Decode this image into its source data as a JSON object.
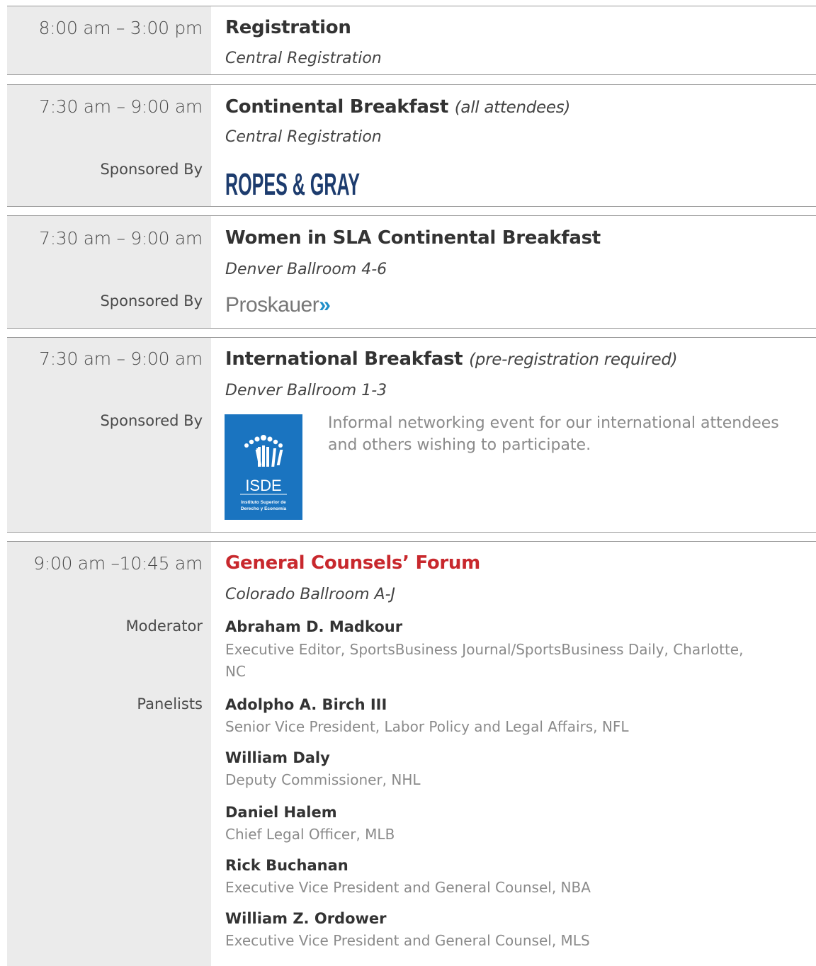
{
  "sessions": [
    {
      "time": "8:00 am – 3:00 pm",
      "title": "Registration",
      "venue": "Central Registration"
    },
    {
      "time": "7:30 am – 9:00 am",
      "title": "Continental Breakfast",
      "title_note": "(all attendees)",
      "venue": "Central Registration",
      "sponsor_label": "Sponsored By",
      "sponsor_logo_text": "ROPES & GRAY"
    },
    {
      "time": "7:30 am – 9:00 am",
      "title": "Women in SLA Continental Breakfast",
      "venue": "Denver Ballroom 4-6",
      "sponsor_label": "Sponsored By",
      "sponsor_logo_text": "Proskauer",
      "sponsor_logo_mark": "»"
    },
    {
      "time": "7:30 am – 9:00 am",
      "title": "International Breakfast",
      "title_note": "(pre-registration required)",
      "venue": "Denver Ballroom 1-3",
      "sponsor_label": "Sponsored By",
      "sponsor_logo_text": "ISDE",
      "sponsor_logo_subtext": "Instituto Superior de Derecho y Economía",
      "description": "Informal networking event for our international attendees and others wishing to participate."
    },
    {
      "time": "9:00 am –10:45 am",
      "title": "General Counsels’ Forum",
      "venue": "Colorado Ballroom A-J",
      "moderator_label": "Moderator",
      "moderator": {
        "name": "Abraham D. Madkour",
        "role": "Executive Editor, SportsBusiness Journal/SportsBusiness Daily, Charlotte, NC"
      },
      "panelists_label": "Panelists",
      "panelists": [
        {
          "name": "Adolpho A. Birch III",
          "role": "Senior Vice President, Labor Policy and Legal Affairs, NFL"
        },
        {
          "name": "William Daly",
          "role": "Deputy Commissioner, NHL"
        },
        {
          "name": "Daniel Halem",
          "role": "Chief Legal Officer, MLB"
        },
        {
          "name": "Rick Buchanan",
          "role": "Executive Vice President and General Counsel, NBA"
        },
        {
          "name": "William Z. Ordower",
          "role": "Executive Vice President and General Counsel, MLS"
        }
      ]
    }
  ],
  "colors": {
    "highlight_title": "#c8282d",
    "left_column_bg": "#ebebeb",
    "isde_blue": "#1a74c0",
    "proskauer_chevron": "#1f8fc9",
    "ropes_navy": "#1d3c6e"
  }
}
